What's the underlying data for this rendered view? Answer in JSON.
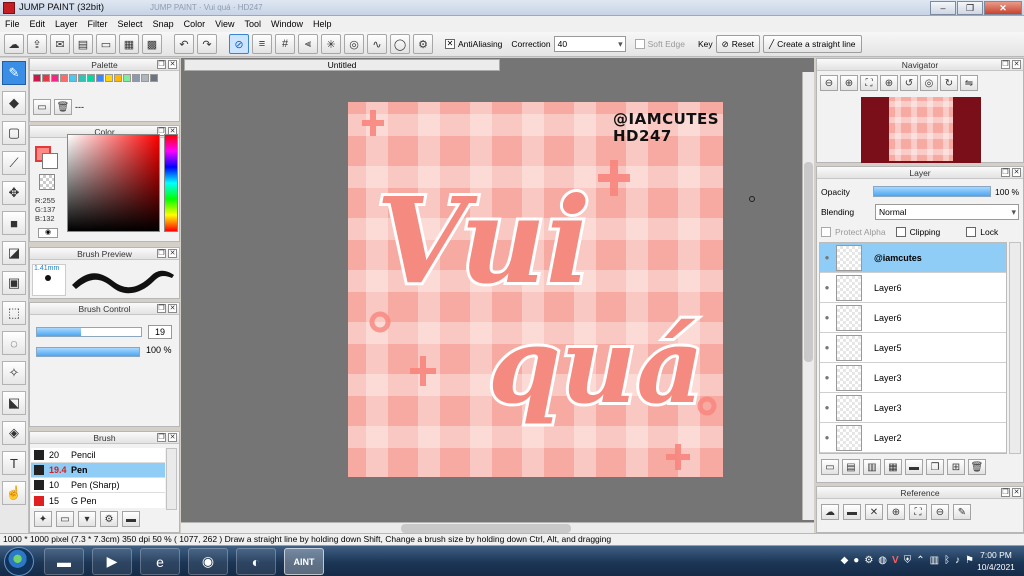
{
  "window": {
    "title": "JUMP PAINT (32bit)",
    "ghost_text": "JUMP PAINT · Vui quá · HD247",
    "minimize": "–",
    "restore": "❐",
    "close": "✕"
  },
  "menu": [
    "File",
    "Edit",
    "Layer",
    "Filter",
    "Select",
    "Snap",
    "Color",
    "View",
    "Tool",
    "Window",
    "Help"
  ],
  "toolbar": {
    "antialiasing_label": "AntiAliasing",
    "correction_label": "Correction",
    "correction_value": "40",
    "soft_edge_label": "Soft Edge",
    "key_label": "Key",
    "reset_label": "Reset",
    "straight_line_label": "Create a straight line"
  },
  "panels": {
    "palette": {
      "title": "Palette",
      "set_name": "---",
      "colors": [
        "#c9184a",
        "#e63946",
        "#f72585",
        "#ff6b6b",
        "#4cc9f0",
        "#2ec4b6",
        "#06d6a0",
        "#3a86ff",
        "#ffd60a",
        "#ffb703",
        "#80ed99",
        "#8d99ae",
        "#adb5bd",
        "#6c757d"
      ]
    },
    "color": {
      "title": "Color",
      "r": "R:255",
      "g": "G:137",
      "b": "B:132"
    },
    "brush_preview": {
      "title": "Brush Preview",
      "size": "1.41mm"
    },
    "brush_control": {
      "title": "Brush Control",
      "size_value": "19",
      "size_fraction": 0.42,
      "opacity_value": "100 %",
      "opacity_fraction": 1.0
    },
    "brush": {
      "title": "Brush",
      "items": [
        {
          "size": "20",
          "name": "Pencil",
          "selected": false
        },
        {
          "size": "19.4",
          "name": "Pen",
          "selected": true
        },
        {
          "size": "10",
          "name": "Pen (Sharp)",
          "selected": false
        },
        {
          "size": "15",
          "name": "G Pen",
          "selected": false
        }
      ]
    },
    "navigator": {
      "title": "Navigator"
    },
    "layer": {
      "title": "Layer",
      "opacity_label": "Opacity",
      "opacity_value": "100 %",
      "opacity_fraction": 1.0,
      "blending_label": "Blending",
      "blending_value": "Normal",
      "protect_alpha_label": "Protect Alpha",
      "clipping_label": "Clipping",
      "lock_label": "Lock",
      "layers": [
        {
          "name": "@iamcutes",
          "selected": true
        },
        {
          "name": "Layer6",
          "selected": false
        },
        {
          "name": "Layer6",
          "selected": false
        },
        {
          "name": "Layer5",
          "selected": false
        },
        {
          "name": "Layer3",
          "selected": false
        },
        {
          "name": "Layer3",
          "selected": false
        },
        {
          "name": "Layer2",
          "selected": false
        }
      ]
    },
    "reference": {
      "title": "Reference"
    }
  },
  "document": {
    "tab_title": "Untitled",
    "art_handle_line1": "@IAMCUTES",
    "art_handle_line2": "HD247",
    "art_line1": "Vui",
    "art_line2": "quá"
  },
  "status": {
    "text": "1000 * 1000 pixel  (7.3 * 7.3cm)  350 dpi  50 %  ( 1077, 262 )  Draw a straight line by holding down Shift, Change a brush size by holding down Ctrl, Alt, and dragging"
  },
  "taskbar": {
    "time": "7:00 PM",
    "date": "10/4/2021",
    "apps": [
      "explorer-icon",
      "media-player-icon",
      "ie-icon",
      "chrome-icon",
      "coccoc-icon",
      "jump-paint-icon"
    ],
    "jump_paint_label": "AINT"
  }
}
